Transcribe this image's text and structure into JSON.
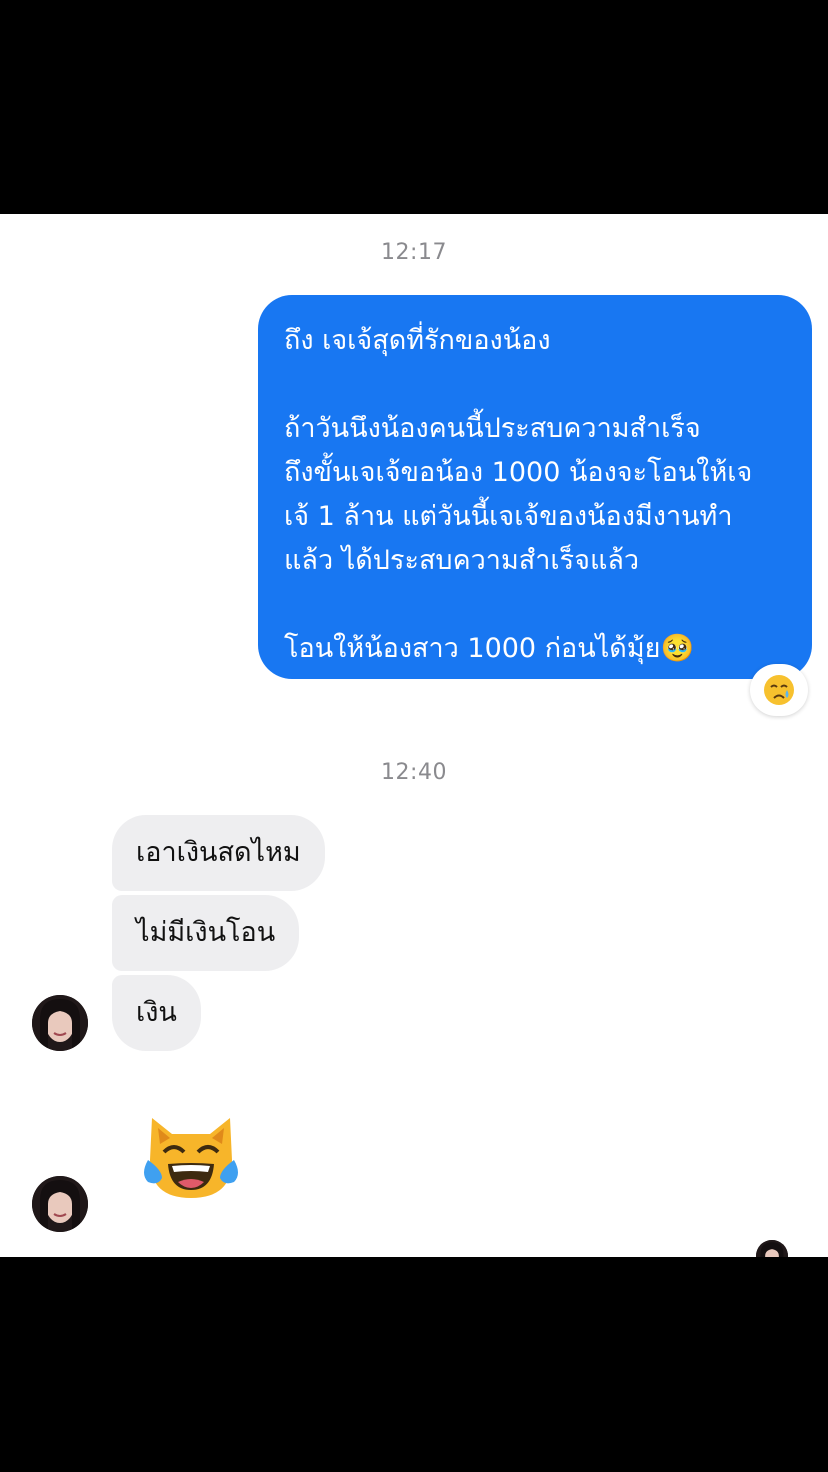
{
  "thread": {
    "timestamp_1": "12:17",
    "outgoing_message": "ถึง เจเจ้สุดที่รักของน้อง\n\nถ้าวันนึงน้องคนนี้ประสบความสำเร็จ\nถึงขั้นเจเจ้ขอน้อง 1000 น้องจะโอนให้เจ\nเจ้ 1 ล้าน แต่วันนี้เจเจ้ของน้องมีงานทำ\nแล้ว ได้ประสบความสำเร็จแล้ว\n\nโอนให้น้องสาว 1000 ก่อนได้มุ้ย🥹",
    "reaction_emoji": "crying-face",
    "timestamp_2": "12:40",
    "incoming_messages": [
      "เอาเงินสดไหม",
      "ไม่มีเงินโอน",
      "เงิน"
    ],
    "sticker_emoji": "cat-with-tears-of-joy"
  },
  "colors": {
    "outgoing_bubble": "#1877f2",
    "incoming_bubble": "#eeeef0",
    "timestamp": "#8a8a8e",
    "letterbox": "#000000"
  }
}
